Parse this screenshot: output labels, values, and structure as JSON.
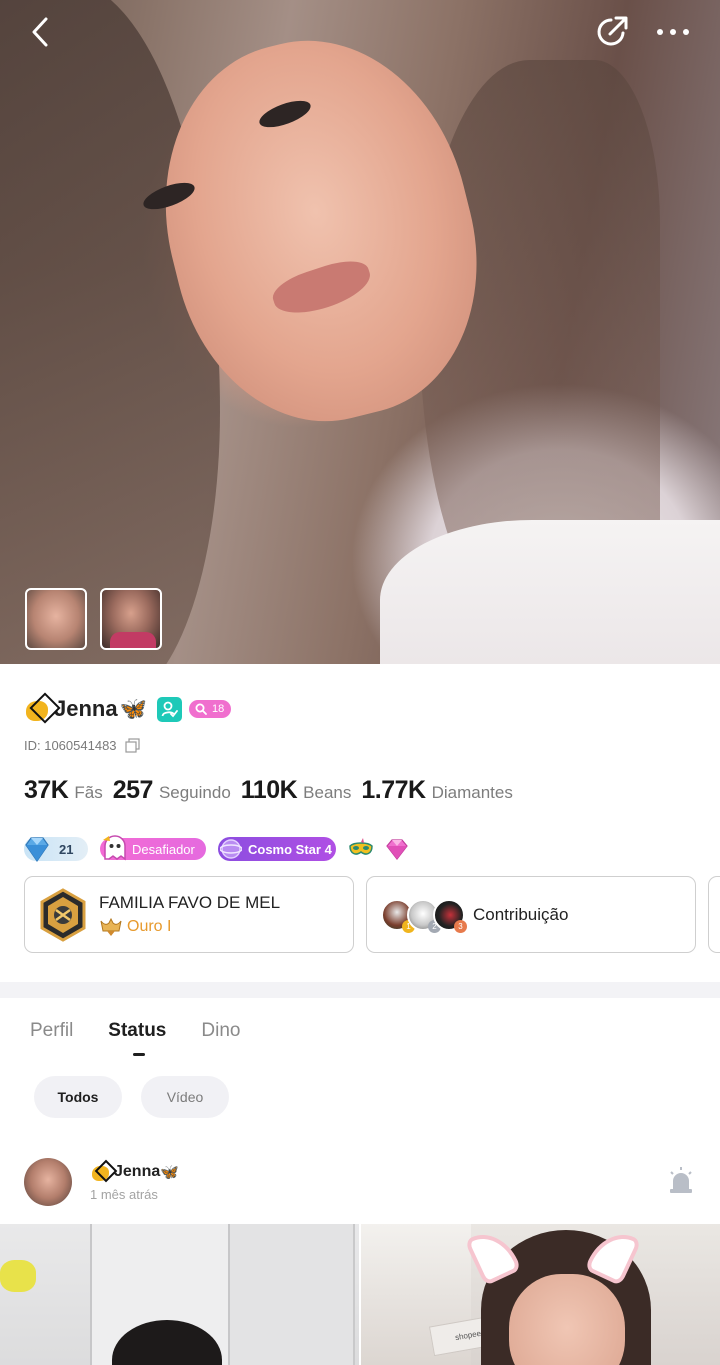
{
  "profile": {
    "name": "Jenna",
    "butterfly": "🦋",
    "level": "18",
    "id_text": "ID: 1060541483"
  },
  "stats": [
    {
      "value": "37K",
      "label": "Fãs"
    },
    {
      "value": "257",
      "label": "Seguindo"
    },
    {
      "value": "110K",
      "label": "Beans"
    },
    {
      "value": "1.77K",
      "label": "Diamantes"
    }
  ],
  "badges": {
    "diamond_level": "21",
    "challenger": "Desafiador",
    "cosmo": "Cosmo Star 4"
  },
  "family": {
    "name": "FAMILIA FAVO DE MEL",
    "rank": "Ouro I"
  },
  "contribution": {
    "label": "Contribuição",
    "ranks": [
      "1",
      "2",
      "3"
    ]
  },
  "tabs": [
    {
      "label": "Perfil",
      "active": false
    },
    {
      "label": "Status",
      "active": true
    },
    {
      "label": "Dino",
      "active": false
    }
  ],
  "filters": {
    "all": "Todos",
    "video": "Vídeo"
  },
  "post": {
    "author": "Jenna",
    "time": "1 mês atrás",
    "box_text": "shopee"
  },
  "icons": {
    "back": "chevron-left-icon",
    "share": "share-icon",
    "more": "more-icon",
    "copy": "copy-icon",
    "report": "siren-icon"
  },
  "colors": {
    "verify": "#1ec9b8",
    "level_pill": "#f06fce",
    "family_rank": "#e79a2d",
    "cosmo": "#8c4de0"
  }
}
